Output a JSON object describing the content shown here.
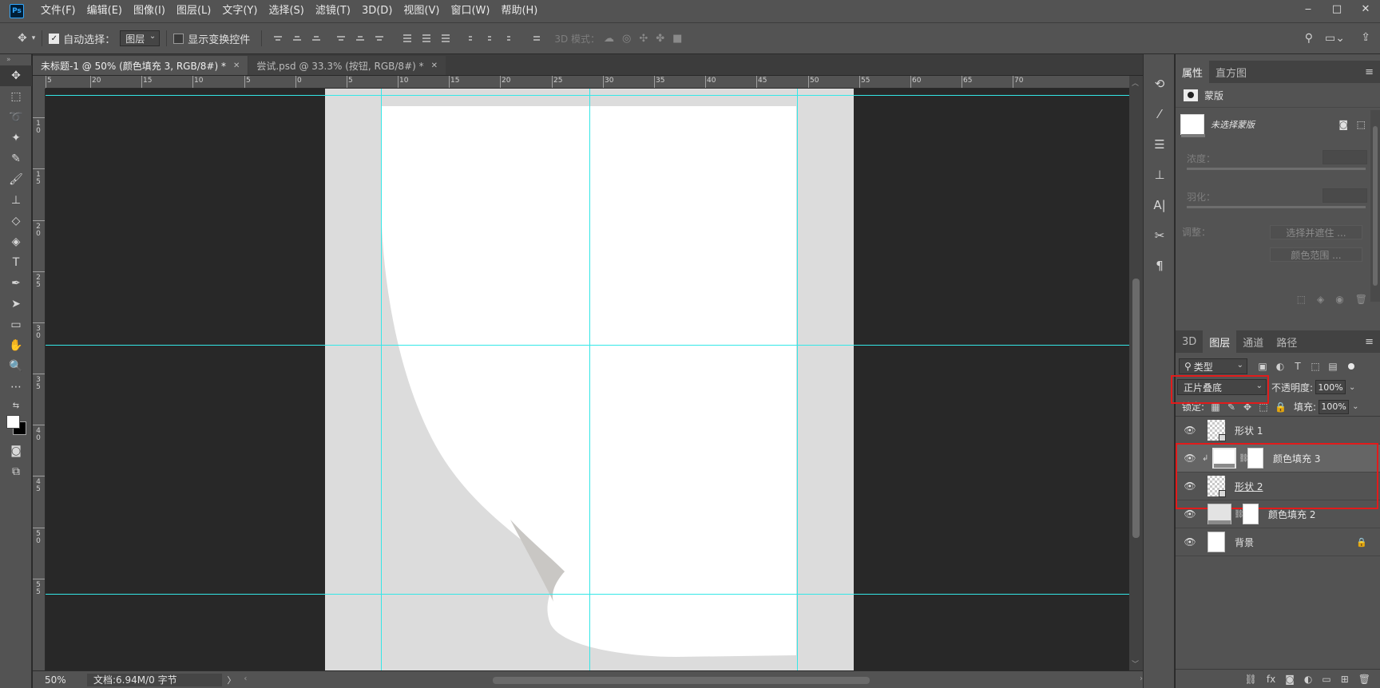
{
  "menubar": {
    "logo": "Ps",
    "items": [
      "文件(F)",
      "编辑(E)",
      "图像(I)",
      "图层(L)",
      "文字(Y)",
      "选择(S)",
      "滤镜(T)",
      "3D(D)",
      "视图(V)",
      "窗口(W)",
      "帮助(H)"
    ],
    "window_controls": [
      "‒",
      "□",
      "✕"
    ]
  },
  "options": {
    "auto_select_label": "自动选择：",
    "auto_select_value": "图层",
    "show_transform_label": "显示变换控件",
    "mode_3d_label": "3D 模式："
  },
  "tabs": [
    {
      "label": "未标题-1 @ 50% (颜色填充 3, RGB/8#) *",
      "close": "✕"
    },
    {
      "label": "尝试.psd @ 33.3% (按钮, RGB/8#) *",
      "close": "✕"
    }
  ],
  "ruler": {
    "top": [
      "5",
      "20",
      "15",
      "10",
      "5",
      "0",
      "5",
      "10",
      "15",
      "20",
      "25",
      "30",
      "35",
      "40",
      "45",
      "50",
      "55",
      "60",
      "65",
      "70"
    ],
    "left": [
      "1\n0",
      "1\n5",
      "2\n0",
      "2\n5",
      "3\n0",
      "3\n5",
      "4\n0",
      "4\n5",
      "5\n0",
      "5\n5"
    ]
  },
  "status": {
    "zoom": "50%",
    "doc_info": "文档:6.94M/0 字节",
    "arrow": "〉"
  },
  "properties": {
    "tabs": [
      "属性",
      "直方图"
    ],
    "section": "蒙版",
    "no_selection": "未选择蒙版",
    "density_label": "浓度：",
    "feather_label": "羽化：",
    "adjust_label": "调整：",
    "select_and_mask_btn": "选择并遮住 ...",
    "color_range_btn": "颜色范围 ..."
  },
  "layers_panel": {
    "tabs": [
      "3D",
      "图层",
      "通道",
      "路径"
    ],
    "kind": "类型",
    "blend_mode": "正片叠底",
    "opacity_label": "不透明度:",
    "opacity": "100%",
    "lock_label": "锁定:",
    "fill_label": "填充:",
    "fill": "100%",
    "layers": [
      {
        "name": "形状 1"
      },
      {
        "name": "颜色填充 3"
      },
      {
        "name": "形状 2"
      },
      {
        "name": "颜色填充 2"
      },
      {
        "name": "背景"
      }
    ]
  },
  "colors": {
    "guide": "#34e7e7",
    "highlight": "#e21b1b",
    "canvas_bg": "#282828",
    "artboard": "#dcdcdc"
  }
}
